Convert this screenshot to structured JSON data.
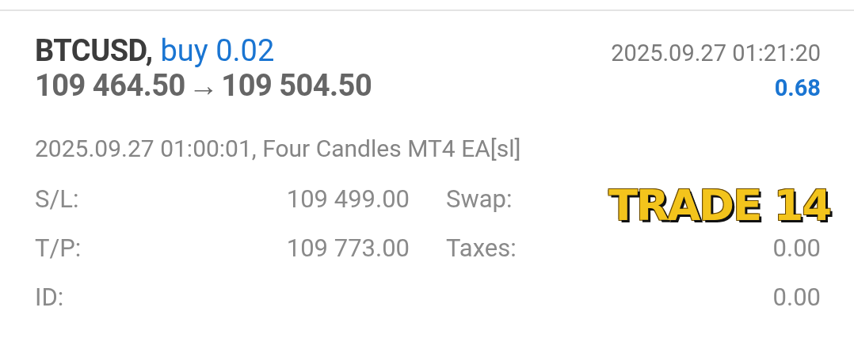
{
  "trade": {
    "symbol": "BTCUSD,",
    "side": "buy 0.02",
    "open_time": "2025.09.27 01:21:20",
    "open_price": "109 464.50",
    "arrow": "→",
    "close_price": "109 504.50",
    "profit": "0.68",
    "comment": "2025.09.27 01:00:01, Four Candles MT4 EA[sl]"
  },
  "details": [
    {
      "label": "S/L:",
      "value": "109 499.00",
      "label_2": "Swap:"
    },
    {
      "label": "T/P:",
      "value": "109 773.00",
      "label_2": "Taxes:",
      "value_2": "0.00"
    },
    {
      "label": "ID:",
      "value_2": "0.00"
    }
  ],
  "overlay_label": "TRADE 14"
}
